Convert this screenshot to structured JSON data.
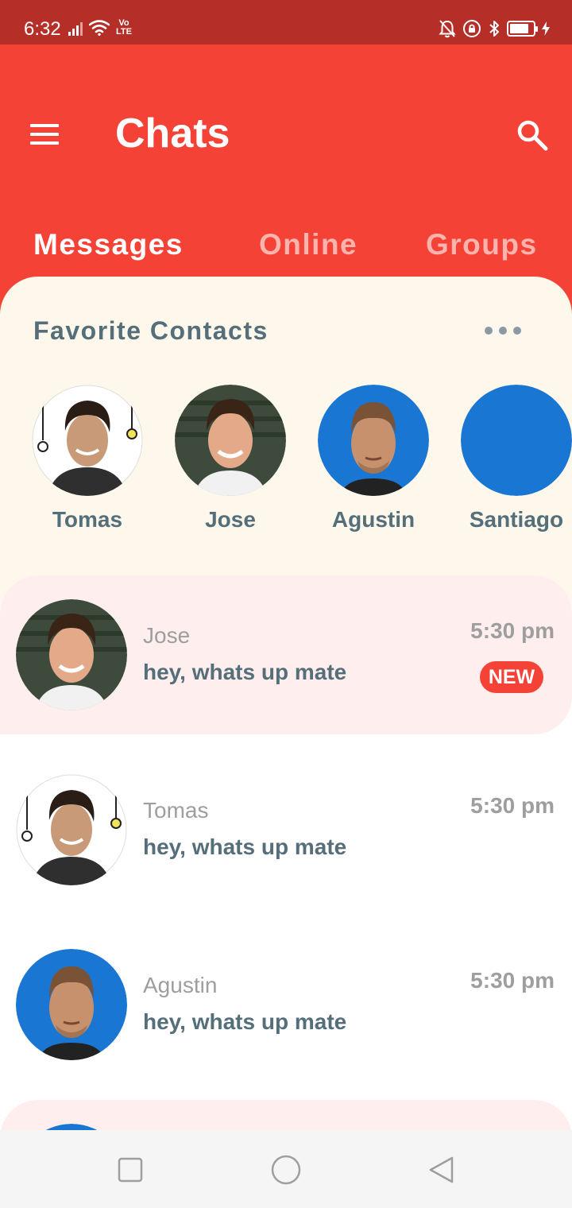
{
  "status_bar": {
    "time": "6:32",
    "volte_top": "Vo",
    "volte_bottom": "LTE",
    "battery_level": 0.85,
    "icons": [
      "signal-icon",
      "wifi-icon",
      "volte-icon",
      "bell-off-icon",
      "rotation-lock-icon",
      "bluetooth-icon",
      "battery-icon",
      "charging-icon"
    ]
  },
  "header": {
    "title": "Chats",
    "menu_icon": "hamburger-menu-icon",
    "search_icon": "search-icon",
    "tabs": [
      {
        "label": "Messages",
        "active": true
      },
      {
        "label": "Online",
        "active": false
      },
      {
        "label": "Groups",
        "active": false
      }
    ]
  },
  "favorites": {
    "title": "Favorite Contacts",
    "more_icon": "more-horizontal-icon",
    "contacts": [
      {
        "name": "Tomas"
      },
      {
        "name": "Jose"
      },
      {
        "name": "Agustin"
      },
      {
        "name": "Santiago"
      }
    ]
  },
  "chats": [
    {
      "name": "Jose",
      "message": "hey, whats up mate",
      "time": "5:30 pm",
      "badge": "NEW",
      "unread": true
    },
    {
      "name": "Tomas",
      "message": "hey, whats up mate",
      "time": "5:30 pm",
      "unread": false
    },
    {
      "name": "Agustin",
      "message": "hey, whats up mate",
      "time": "5:30 pm",
      "unread": false
    }
  ],
  "colors": {
    "primary": "#f44336",
    "status_bar": "#b52f28",
    "favorites_bg": "#fef8ec",
    "unread_bg": "#ffeeee",
    "text_secondary": "#546e7a",
    "avatar_blue": "#1976d2"
  },
  "nav_bar": {
    "icons": [
      "recent-apps-icon",
      "home-icon",
      "back-icon"
    ]
  }
}
